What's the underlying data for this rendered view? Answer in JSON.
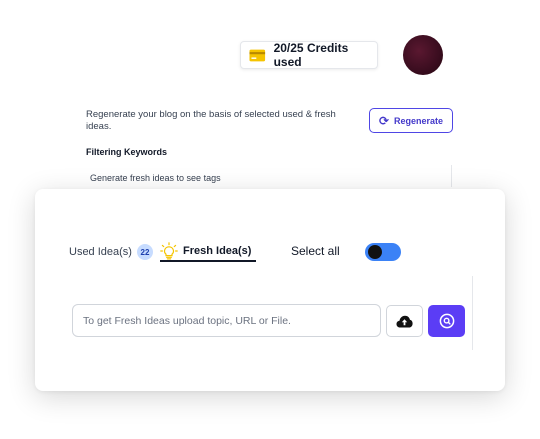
{
  "header": {
    "credits_label": "20/25 Credits used",
    "credits_icon": "credit-card-icon",
    "avatar_icon": "user-avatar"
  },
  "blog_panel": {
    "regenerate_text": "Regenerate your blog on the basis of selected used & fresh ideas.",
    "regenerate_button": "Regenerate",
    "filtering_title": "Filtering Keywords",
    "filtering_hint": "Generate fresh ideas to see tags"
  },
  "ideas_card": {
    "tabs": [
      {
        "label": "Used Idea(s)",
        "count": "22",
        "active": false
      },
      {
        "label": "Fresh Idea(s)",
        "icon": "lightbulb-icon",
        "active": true
      }
    ],
    "select_all_label": "Select all",
    "select_all_on": true,
    "input_placeholder": "To get Fresh Ideas upload topic, URL or File.",
    "input_value": "",
    "upload_icon": "cloud-upload-icon",
    "search_icon": "search-icon"
  },
  "colors": {
    "accent": "#5b3df5",
    "regenerate_border": "#4f46e5",
    "toggle_on": "#3b82f6",
    "badge_bg": "#c7dcff",
    "credit_card": "#f5c400",
    "bulb": "#f5c400"
  }
}
